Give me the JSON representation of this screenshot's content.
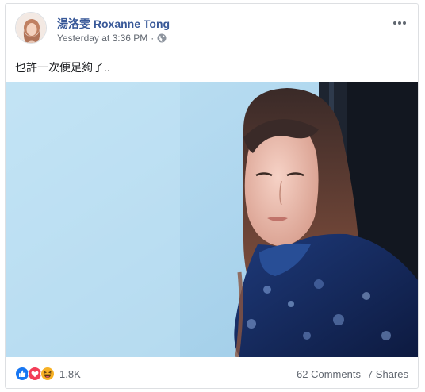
{
  "post": {
    "author": "湯洛雯 Roxanne Tong",
    "timestamp": "Yesterday at 3:36 PM",
    "separator": "·",
    "privacy_icon": "globe-icon",
    "more_icon": "more-options-icon",
    "caption": "也許一次便足夠了..",
    "reactions": {
      "icons": [
        "like-icon",
        "love-icon",
        "haha-icon"
      ],
      "count": "1.8K"
    },
    "comments": "62 Comments",
    "shares": "7 Shares"
  },
  "colors": {
    "author_link": "#385898",
    "meta_text": "#616770",
    "like_blue": "#1877f2",
    "love_red": "#f33e58",
    "haha_yellow": "#f7b125"
  }
}
